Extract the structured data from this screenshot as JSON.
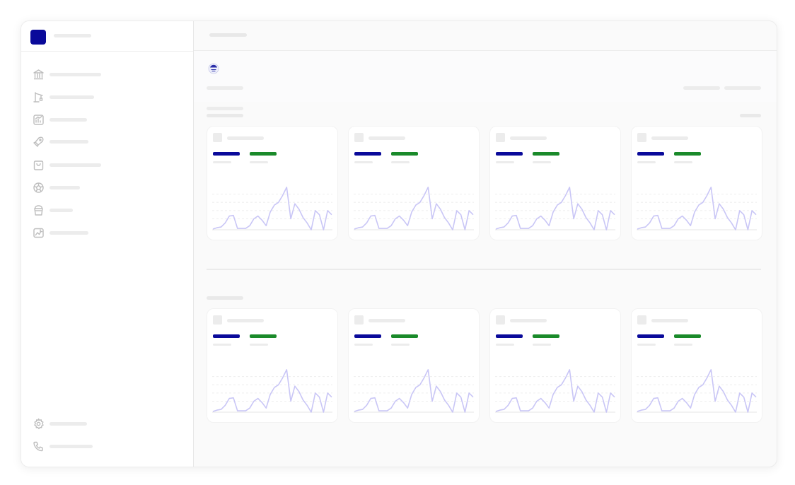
{
  "app": {
    "accent_color": "#0a0a9a",
    "positive_color": "#1a8a2a",
    "sparkline_color": "#c9c6f6"
  },
  "sidebar": {
    "logo": "square-logo",
    "nav_items": [
      {
        "icon": "bank-icon"
      },
      {
        "icon": "crane-icon"
      },
      {
        "icon": "chart-box-icon"
      },
      {
        "icon": "rocket-icon"
      },
      {
        "icon": "shopping-bag-icon"
      },
      {
        "icon": "soccer-ball-icon"
      },
      {
        "icon": "bucket-icon"
      },
      {
        "icon": "image-chart-icon"
      }
    ],
    "footer_items": [
      {
        "icon": "gear-icon"
      },
      {
        "icon": "phone-icon"
      }
    ]
  },
  "main": {
    "brand_icon": "globe-icon",
    "sections": [
      {
        "cards": [
          {},
          {},
          {},
          {}
        ]
      },
      {
        "cards": [
          {},
          {},
          {},
          {}
        ]
      }
    ]
  },
  "chart_data": {
    "type": "line",
    "note_free": true,
    "x": [
      0,
      1,
      2,
      3,
      4,
      5,
      6,
      7,
      8,
      9,
      10,
      11,
      12,
      13,
      14,
      15,
      16,
      17,
      18,
      19,
      20,
      21,
      22,
      23,
      24,
      25,
      26,
      27,
      28,
      29
    ],
    "values": [
      1,
      3,
      4,
      10,
      20,
      21,
      2,
      2,
      2,
      6,
      16,
      20,
      14,
      6,
      26,
      36,
      40,
      50,
      62,
      16,
      38,
      30,
      18,
      10,
      0,
      28,
      22,
      0,
      28,
      22
    ],
    "ylim": [
      0,
      64
    ],
    "grid": true
  }
}
